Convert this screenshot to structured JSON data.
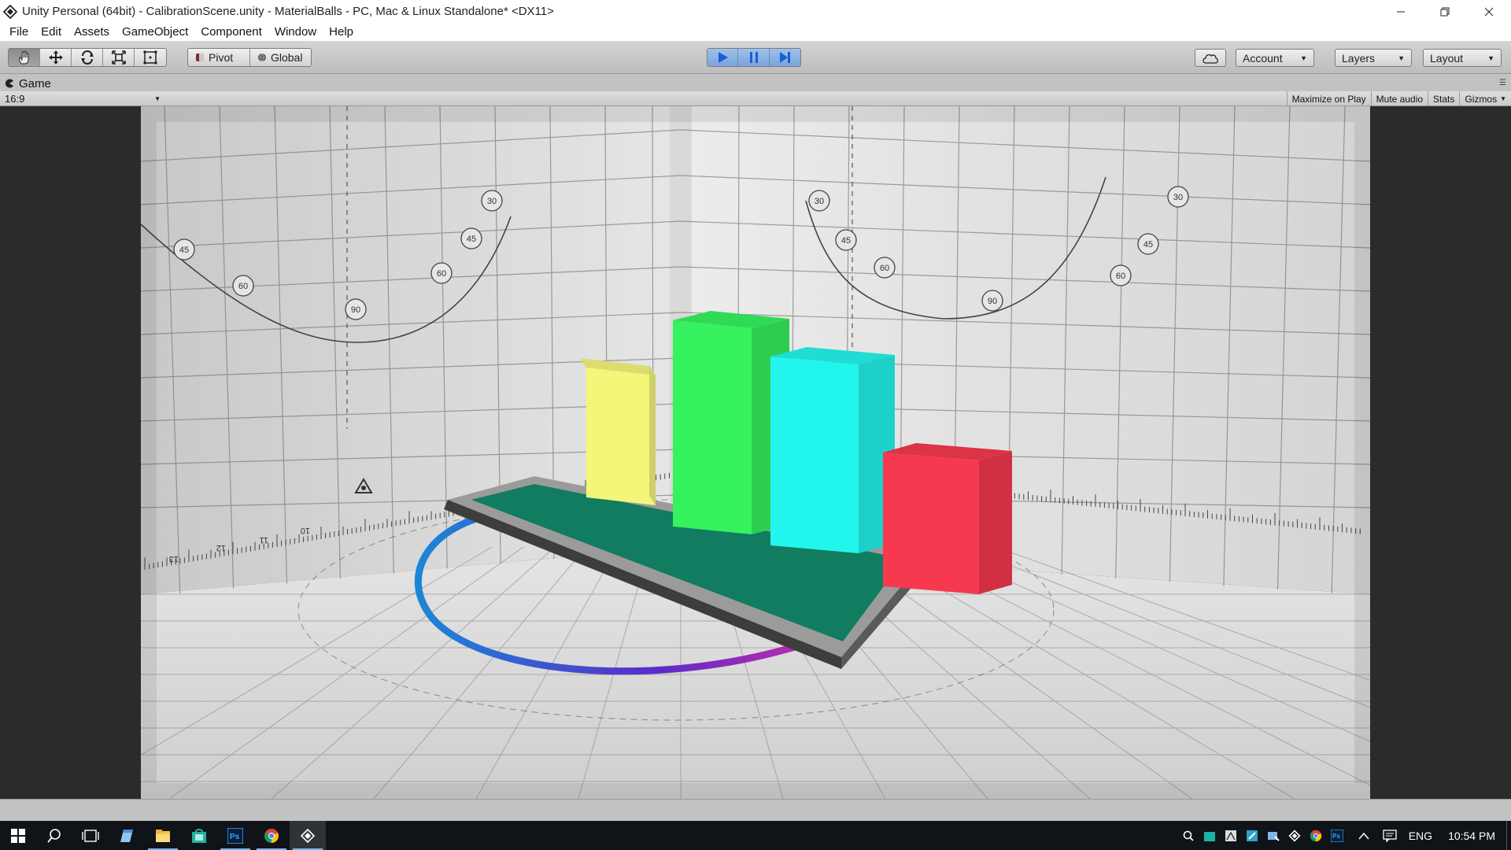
{
  "window": {
    "title": "Unity Personal (64bit) - CalibrationScene.unity - MaterialBalls - PC, Mac & Linux Standalone* <DX11>"
  },
  "menu": [
    "File",
    "Edit",
    "Assets",
    "GameObject",
    "Component",
    "Window",
    "Help"
  ],
  "toolbar": {
    "transform_tools": [
      "hand-tool-icon",
      "move-tool-icon",
      "rotate-tool-icon",
      "scale-tool-icon",
      "rect-tool-icon"
    ],
    "active_tool": "hand-tool-icon",
    "pivot_label": "Pivot",
    "global_label": "Global",
    "play_active": true,
    "account_label": "Account",
    "layers_label": "Layers",
    "layout_label": "Layout"
  },
  "game_view": {
    "tab_label": "Game",
    "aspect": "16:9",
    "maximize_label": "Maximize on Play",
    "mute_label": "Mute audio",
    "stats_label": "Stats",
    "gizmos_label": "Gizmos"
  },
  "scene": {
    "dial_labels_left": [
      "45",
      "60",
      "90",
      "60",
      "45",
      "30"
    ],
    "dial_labels_right": [
      "30",
      "45",
      "60",
      "90",
      "60",
      "45",
      "30"
    ],
    "ruler_labels_left": [
      "13",
      "12",
      "11",
      "10"
    ],
    "bars": [
      {
        "name": "yellow",
        "color": "#f4f67a"
      },
      {
        "name": "green",
        "color": "#35f25e"
      },
      {
        "name": "cyan",
        "color": "#22f6ec"
      },
      {
        "name": "red",
        "color": "#f6394f"
      }
    ],
    "base_color": "#117c5f"
  },
  "taskbar": {
    "apps": [
      "start-icon",
      "search-icon",
      "task-view-icon",
      "notepad-icon",
      "file-explorer-icon",
      "store-icon",
      "photoshop-icon",
      "chrome-icon",
      "unity-icon"
    ],
    "running": [
      "file-explorer-icon",
      "photoshop-icon",
      "chrome-icon",
      "unity-icon"
    ],
    "active": "unity-icon",
    "language": "ENG",
    "time": "10:54 PM"
  }
}
